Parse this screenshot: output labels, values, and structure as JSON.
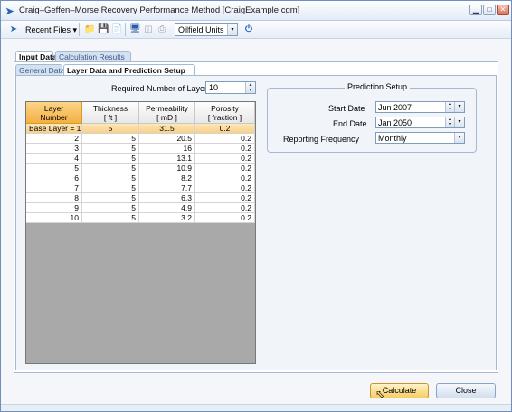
{
  "window": {
    "title": "Craig–Geffen–Morse Recovery Performance Method [CraigExample.cgm]",
    "min_glyph": "▁",
    "max_glyph": "□",
    "close_glyph": "✕"
  },
  "toolbar": {
    "recent_files_label": "Recent Files",
    "recent_files_arrow": "▾",
    "units_value": "Oilfield Units",
    "units_arrow": "▾",
    "icons": [
      "open-folder-icon",
      "save-icon",
      "document-icon",
      "monitor-icon",
      "export-icon",
      "print-icon",
      "settings-icon",
      "power-icon"
    ]
  },
  "main_tabs": [
    {
      "label": "Input Data",
      "active": true
    },
    {
      "label": "Calculation Results",
      "active": false
    }
  ],
  "sub_tabs": [
    {
      "label": "General Data",
      "active": false
    },
    {
      "label": "Layer Data and Prediction Setup",
      "active": true
    }
  ],
  "layers": {
    "required_label": "Required Number of Layers",
    "required_value": "10",
    "headers": [
      [
        "Layer",
        "Number"
      ],
      [
        "Thickness",
        "[ ft ]"
      ],
      [
        "Permeability",
        "[ mD ]"
      ],
      [
        "Porosity",
        "[ fraction ]"
      ]
    ],
    "base_row": [
      "Base Layer = 1",
      "5",
      "31.5",
      "0.2"
    ],
    "rows": [
      [
        "2",
        "5",
        "20.5",
        "0.2"
      ],
      [
        "3",
        "5",
        "16",
        "0.2"
      ],
      [
        "4",
        "5",
        "13.1",
        "0.2"
      ],
      [
        "5",
        "5",
        "10.9",
        "0.2"
      ],
      [
        "6",
        "5",
        "8.2",
        "0.2"
      ],
      [
        "7",
        "5",
        "7.7",
        "0.2"
      ],
      [
        "8",
        "5",
        "6.3",
        "0.2"
      ],
      [
        "9",
        "5",
        "4.9",
        "0.2"
      ],
      [
        "10",
        "5",
        "3.2",
        "0.2"
      ]
    ]
  },
  "prediction": {
    "title": "Prediction Setup",
    "start_label": "Start Date",
    "start_value": "Jun 2007",
    "end_label": "End Date",
    "end_value": "Jan 2050",
    "freq_label": "Reporting Frequency",
    "freq_value": "Monthly",
    "dropdown_arrow": "▾",
    "spin_up": "▲",
    "spin_down": "▼"
  },
  "buttons": {
    "calculate": "Calculate",
    "close": "Close"
  },
  "colors": {
    "accent_orange": "#f4b042",
    "frame_blue": "#6f8fbf"
  }
}
